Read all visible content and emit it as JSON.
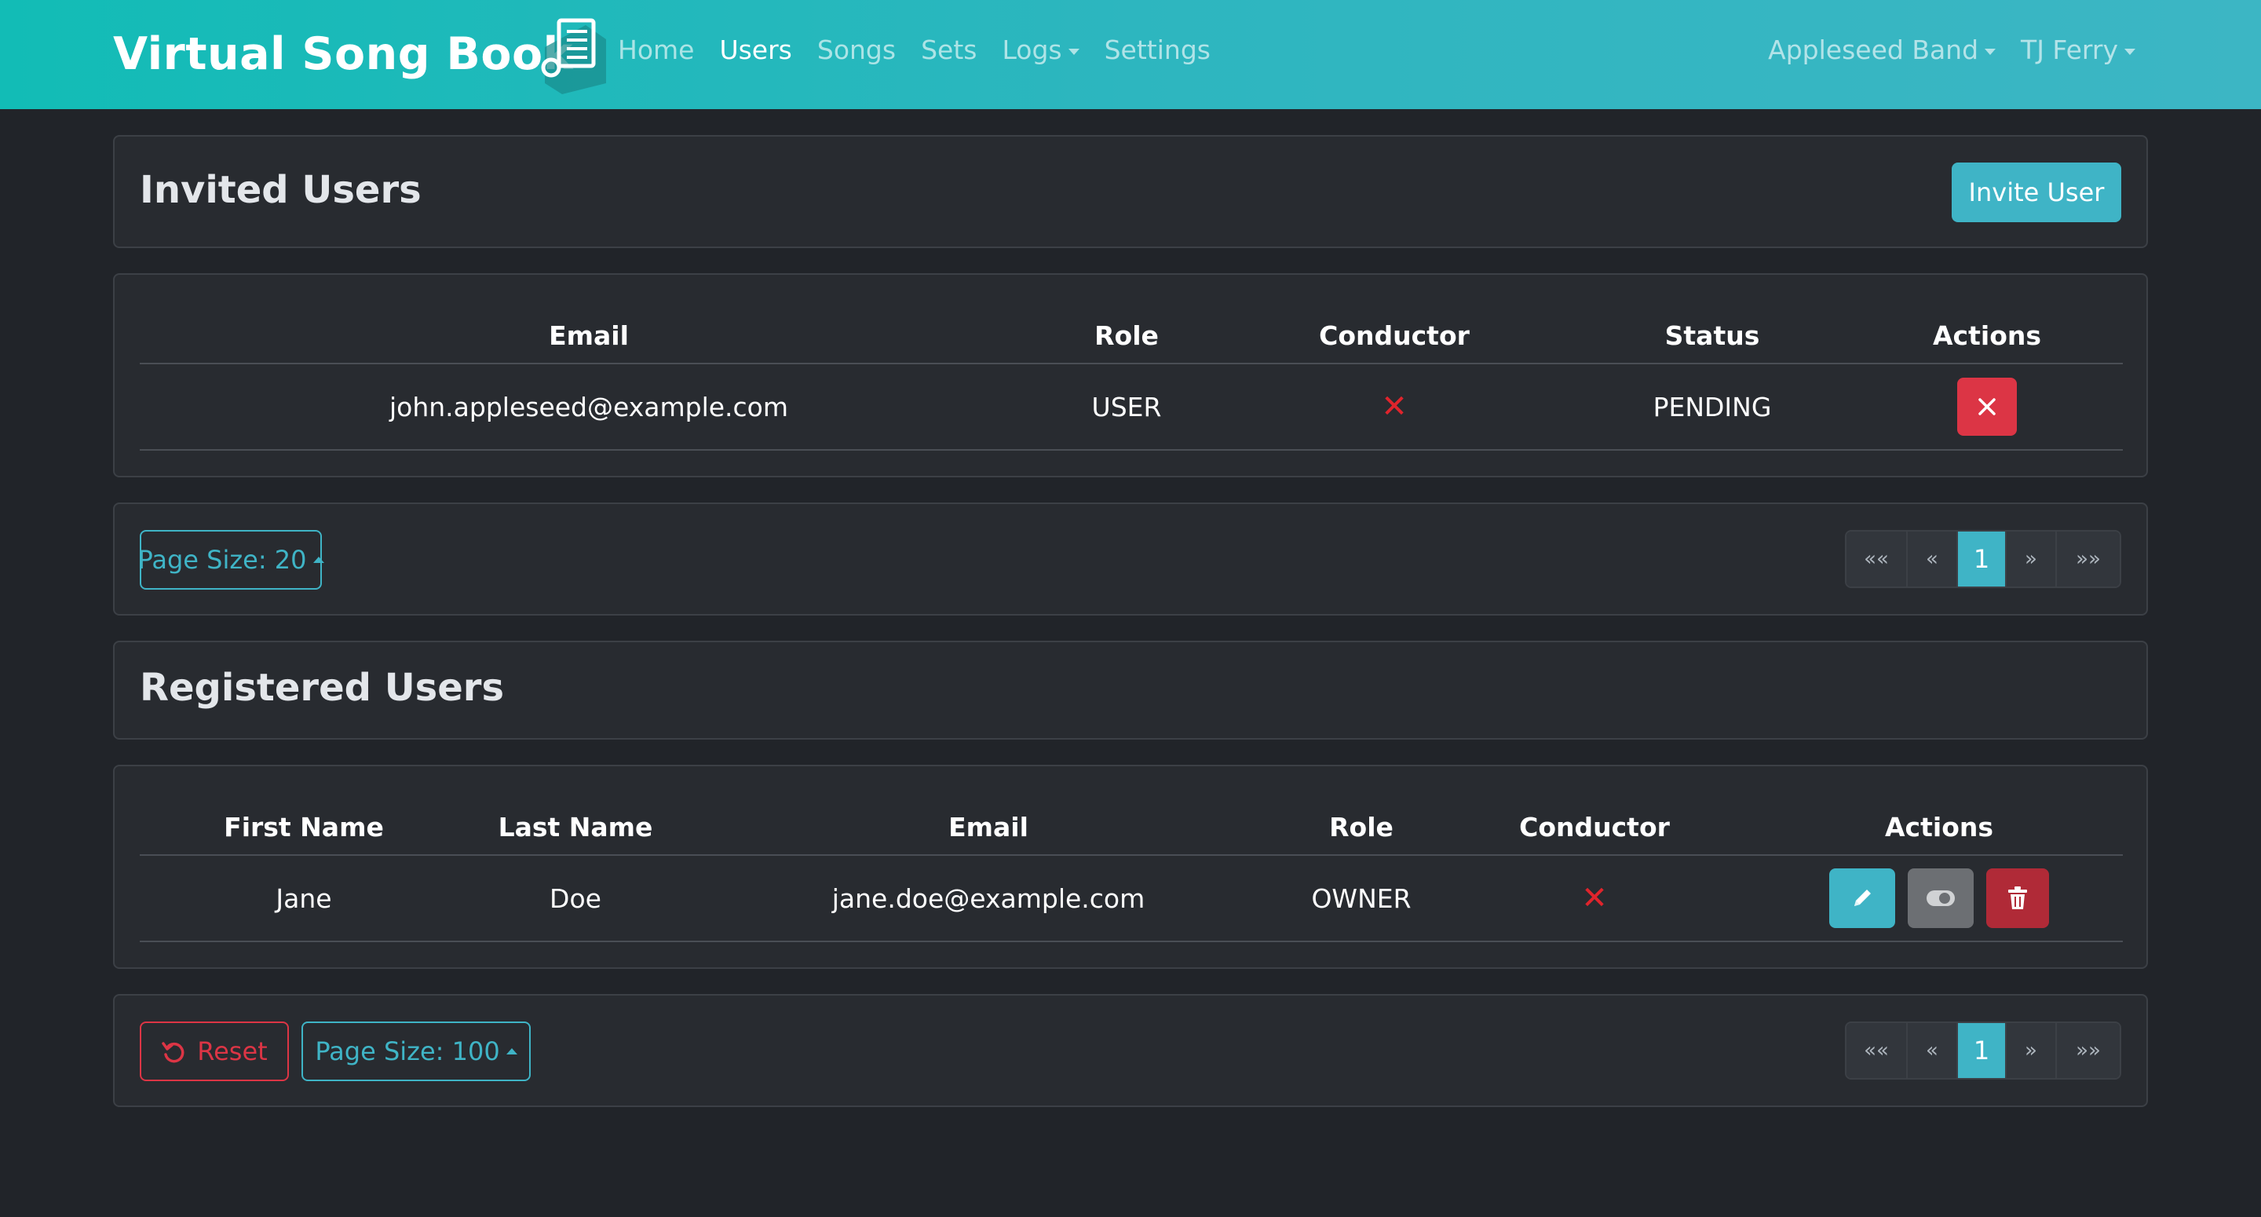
{
  "navbar": {
    "brand": "Virtual Song Book",
    "links": [
      "Home",
      "Users",
      "Songs",
      "Sets",
      "Logs",
      "Settings"
    ],
    "active": "Users",
    "band": "Appleseed Band",
    "user": "TJ Ferry"
  },
  "invited": {
    "title": "Invited Users",
    "invite_button": "Invite User",
    "columns": [
      "Email",
      "Role",
      "Conductor",
      "Status",
      "Actions"
    ],
    "rows": [
      {
        "email": "john.appleseed@example.com",
        "role": "USER",
        "conductor": "✕",
        "status": "PENDING"
      }
    ],
    "page_size_label": "Page Size: 20",
    "pagination": [
      "««",
      "«",
      "1",
      "»",
      "»»"
    ]
  },
  "registered": {
    "title": "Registered Users",
    "columns": [
      "First Name",
      "Last Name",
      "Email",
      "Role",
      "Conductor",
      "Actions"
    ],
    "rows": [
      {
        "first": "Jane",
        "last": "Doe",
        "email": "jane.doe@example.com",
        "role": "OWNER",
        "conductor": "✕"
      }
    ],
    "reset_label": "Reset",
    "page_size_label": "Page Size: 100",
    "pagination": [
      "««",
      "«",
      "1",
      "»",
      "»»"
    ]
  },
  "colors": {
    "accent": "#3fb4c6",
    "danger": "#dc3545",
    "navbar": "#12bcb6",
    "background": "#212429",
    "card": "#282b30"
  },
  "icons": {
    "logo": "song-book-icon",
    "remove": "close-icon",
    "edit": "pencil-icon",
    "toggle": "toggle-icon",
    "delete": "trash-icon",
    "reset": "undo-icon"
  }
}
